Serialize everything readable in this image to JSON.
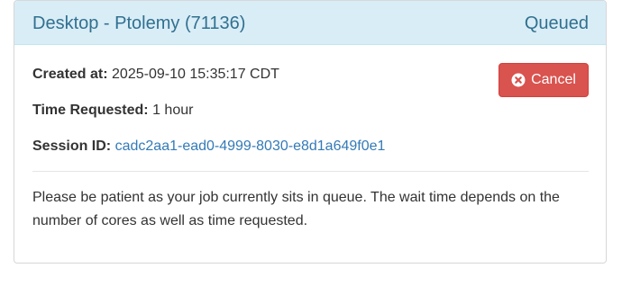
{
  "panel": {
    "title": "Desktop - Ptolemy (71136)",
    "status": "Queued",
    "created_label": "Created at:",
    "created_value": "2025-09-10 15:35:17 CDT",
    "time_label": "Time Requested:",
    "time_value": "1 hour",
    "session_label": "Session ID:",
    "session_value": "cadc2aa1-ead0-4999-8030-e8d1a649f0e1",
    "cancel_label": "Cancel",
    "cancel_icon": "times-circle-icon",
    "message": "Please be patient as your job currently sits in queue. The wait time depends on the number of cores as well as time requested."
  },
  "colors": {
    "heading_bg": "#d9edf7",
    "heading_text": "#31708f",
    "danger": "#d9534f",
    "link": "#337ab7"
  }
}
